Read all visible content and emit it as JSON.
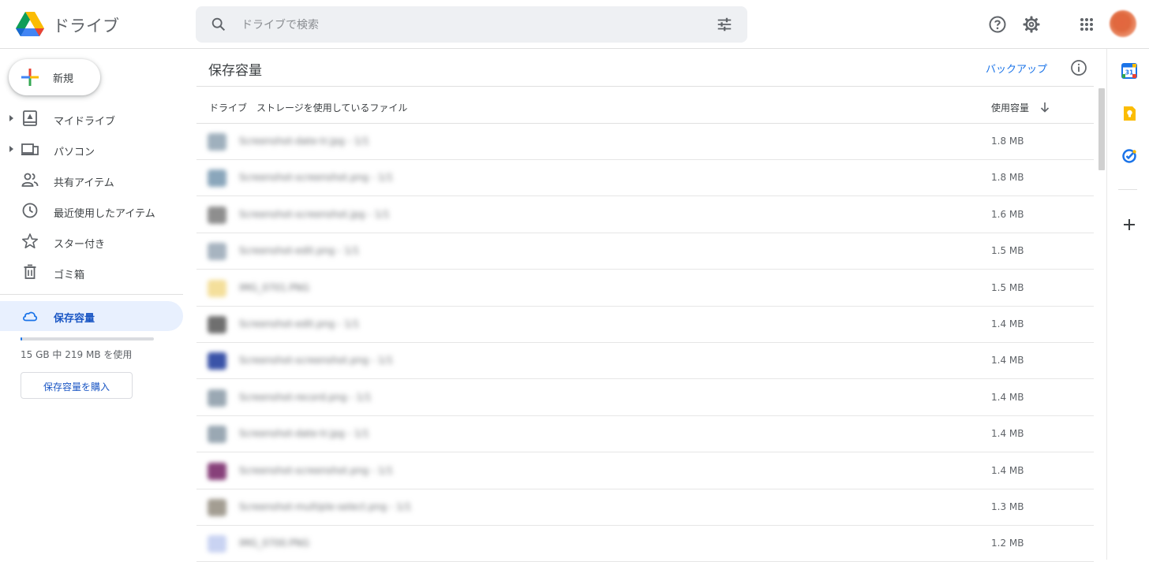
{
  "header": {
    "app_name": "ドライブ",
    "search_placeholder": "ドライブで検索"
  },
  "sidebar": {
    "new_label": "新規",
    "items": [
      {
        "label": "マイドライブ",
        "icon": "my-drive-icon",
        "expandable": true
      },
      {
        "label": "パソコン",
        "icon": "computers-icon",
        "expandable": true
      },
      {
        "label": "共有アイテム",
        "icon": "shared-icon",
        "expandable": false
      },
      {
        "label": "最近使用したアイテム",
        "icon": "recent-clock-icon",
        "expandable": false
      },
      {
        "label": "スター付き",
        "icon": "star-icon",
        "expandable": false
      },
      {
        "label": "ゴミ箱",
        "icon": "trash-icon",
        "expandable": false
      }
    ],
    "storage_item": {
      "label": "保存容量",
      "icon": "cloud-icon"
    },
    "quota_used_fraction": 0.014,
    "quota_text": "15 GB 中 219 MB を使用",
    "buy_storage_label": "保存容量を購入"
  },
  "main": {
    "title": "保存容量",
    "backup_label": "バックアップ",
    "col_name": "ドライブ　ストレージを使用しているファイル",
    "col_size": "使用容量",
    "rows": [
      {
        "name": "Screenshot-date-tr.jpg - 1/1",
        "size": "1.8 MB",
        "thumb": "#9fb0bd"
      },
      {
        "name": "Screenshot-screenshot.png - 1/1",
        "size": "1.8 MB",
        "thumb": "#8aa6bb"
      },
      {
        "name": "Screenshot-screenshot.jpg - 1/1",
        "size": "1.6 MB",
        "thumb": "#8e8e8e"
      },
      {
        "name": "Screenshot-edit.png - 1/1",
        "size": "1.5 MB",
        "thumb": "#a7b4c0"
      },
      {
        "name": "IMG_0701.PNG",
        "size": "1.5 MB",
        "thumb": "#f4df9b"
      },
      {
        "name": "Screenshot-edit.png - 1/1",
        "size": "1.4 MB",
        "thumb": "#6f6f6f"
      },
      {
        "name": "Screenshot-screenshot.png - 1/1",
        "size": "1.4 MB",
        "thumb": "#3a53a8"
      },
      {
        "name": "Screenshot-record.png - 1/1",
        "size": "1.4 MB",
        "thumb": "#9aa8b3"
      },
      {
        "name": "Screenshot-date-tr.jpg - 1/1",
        "size": "1.4 MB",
        "thumb": "#9aa8b3"
      },
      {
        "name": "Screenshot-screenshot.png - 1/1",
        "size": "1.4 MB",
        "thumb": "#87407a"
      },
      {
        "name": "Screenshot-multiple-select.png - 1/1",
        "size": "1.3 MB",
        "thumb": "#a39d92"
      },
      {
        "name": "IMG_0700.PNG",
        "size": "1.2 MB",
        "thumb": "#c9d3f2"
      }
    ]
  },
  "colors": {
    "accent": "#1a73e8",
    "active_bg": "#e8f0fe",
    "search_bg": "#eef0f3"
  },
  "rail": {
    "icons": [
      "calendar-icon",
      "keep-icon",
      "tasks-icon",
      "add-addon-icon"
    ]
  }
}
